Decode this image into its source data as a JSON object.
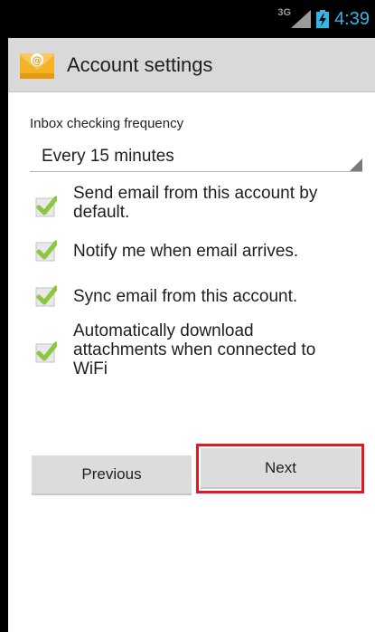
{
  "status_bar": {
    "network": "3G",
    "time": "4:39"
  },
  "action_bar": {
    "title": "Account settings",
    "icon": "email-app-icon"
  },
  "frequency": {
    "label": "Inbox checking frequency",
    "selected": "Every 15 minutes"
  },
  "options": [
    {
      "label_lines": [
        "Send email from this account by",
        "default."
      ],
      "checked": true
    },
    {
      "label_lines": [
        "Notify me when email arrives."
      ],
      "checked": true
    },
    {
      "label_lines": [
        "Sync email from this account."
      ],
      "checked": true
    },
    {
      "label_lines": [
        "Automatically download",
        "attachments when connected to",
        "WiFi"
      ],
      "checked": true
    }
  ],
  "buttons": {
    "previous": "Previous",
    "next": "Next"
  },
  "colors": {
    "accent_clock": "#33b5e5",
    "check_green": "#8dc63f",
    "highlight_red": "#e01a22",
    "action_bar": "#d9d9d9"
  }
}
